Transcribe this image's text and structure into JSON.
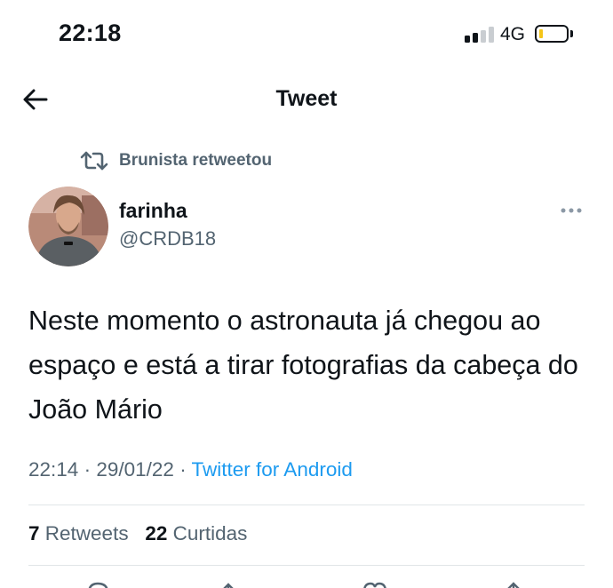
{
  "status_bar": {
    "time": "22:18",
    "network": "4G"
  },
  "nav": {
    "title": "Tweet"
  },
  "retweet_context": {
    "text": "Brunista retweetou"
  },
  "author": {
    "name": "farinha",
    "handle": "@CRDB18"
  },
  "tweet": {
    "text": "Neste momento o astronauta já chegou ao espaço e está a tirar fotografias da cabeça do João Mário",
    "time": "22:14",
    "date": "29/01/22",
    "source": "Twitter for Android"
  },
  "stats": {
    "retweets_count": "7",
    "retweets_label": "Retweets",
    "likes_count": "22",
    "likes_label": "Curtidas"
  },
  "colors": {
    "link": "#1d9bf0",
    "secondary_text": "#536471",
    "battery_level": "#f5c518"
  }
}
